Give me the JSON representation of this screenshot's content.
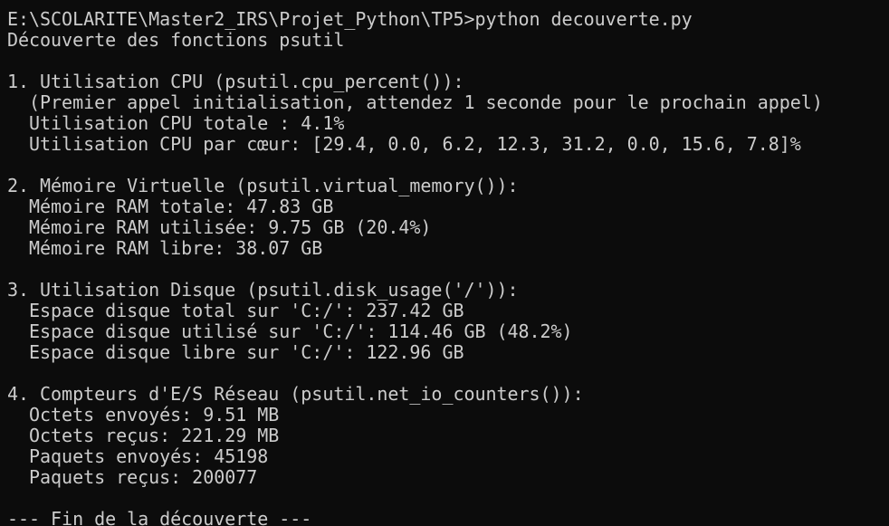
{
  "terminal": {
    "lines": [
      "E:\\SCOLARITE\\Master2_IRS\\Projet_Python\\TP5>python decouverte.py",
      "Découverte des fonctions psutil",
      "",
      "1. Utilisation CPU (psutil.cpu_percent()):",
      "  (Premier appel initialisation, attendez 1 seconde pour le prochain appel)",
      "  Utilisation CPU totale : 4.1%",
      "  Utilisation CPU par cœur: [29.4, 0.0, 6.2, 12.3, 31.2, 0.0, 15.6, 7.8]%",
      "",
      "2. Mémoire Virtuelle (psutil.virtual_memory()):",
      "  Mémoire RAM totale: 47.83 GB",
      "  Mémoire RAM utilisée: 9.75 GB (20.4%)",
      "  Mémoire RAM libre: 38.07 GB",
      "",
      "3. Utilisation Disque (psutil.disk_usage('/')):",
      "  Espace disque total sur 'C:/': 237.42 GB",
      "  Espace disque utilisé sur 'C:/': 114.46 GB (48.2%)",
      "  Espace disque libre sur 'C:/': 122.96 GB",
      "",
      "4. Compteurs d'E/S Réseau (psutil.net_io_counters()):",
      "  Octets envoyés: 9.51 MB",
      "  Octets reçus: 221.29 MB",
      "  Paquets envoyés: 45198",
      "  Paquets reçus: 200077",
      "",
      "--- Fin de la découverte ---"
    ]
  },
  "colors": {
    "background": "#0c0c0c",
    "text": "#cccccc"
  }
}
